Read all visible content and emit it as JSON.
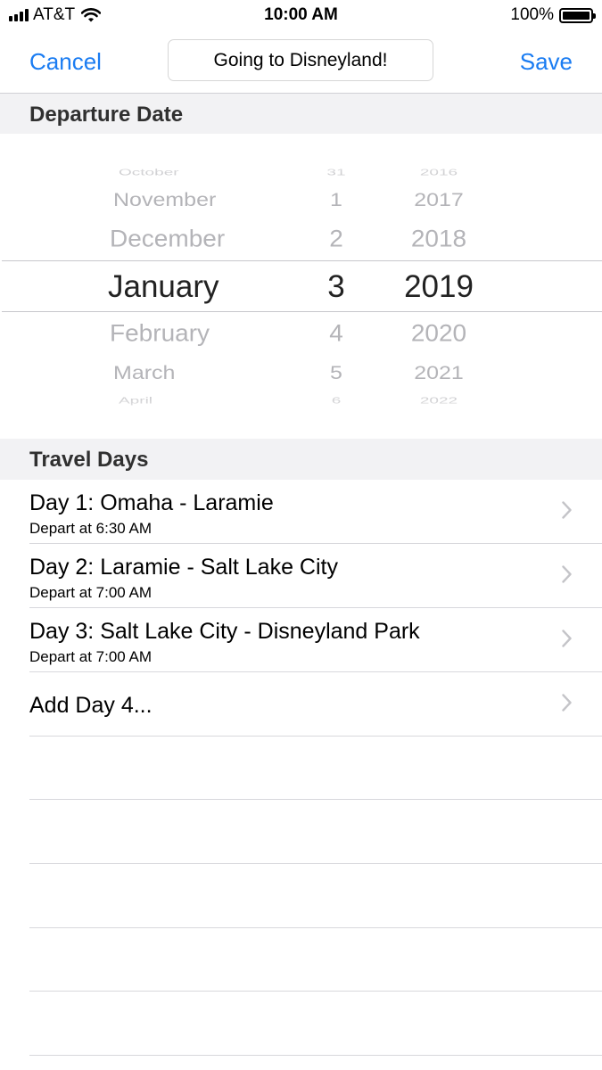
{
  "status_bar": {
    "carrier": "AT&T",
    "time": "10:00 AM",
    "battery": "100%",
    "battery_level": 1.0
  },
  "nav": {
    "cancel_label": "Cancel",
    "title_value": "Going to Disneyland!",
    "save_label": "Save",
    "accent_color": "#1a7cf2"
  },
  "departure": {
    "header": "Departure Date",
    "months": [
      "October",
      "November",
      "December",
      "January",
      "February",
      "March",
      "April"
    ],
    "days": [
      "31",
      "1",
      "2",
      "3",
      "4",
      "5",
      "6"
    ],
    "years": [
      "2016",
      "2017",
      "2018",
      "2019",
      "2020",
      "2021",
      "2022"
    ],
    "selected": {
      "month": "January",
      "day": "3",
      "year": "2019"
    }
  },
  "travel": {
    "header": "Travel Days",
    "days": [
      {
        "title": "Day 1: Omaha - Laramie",
        "subtitle": "Depart at 6:30 AM"
      },
      {
        "title": "Day 2: Laramie - Salt Lake City",
        "subtitle": "Depart at 7:00 AM"
      },
      {
        "title": "Day 3: Salt Lake City - Disneyland Park",
        "subtitle": "Depart at 7:00 AM"
      }
    ],
    "add_label": "Add Day 4..."
  }
}
